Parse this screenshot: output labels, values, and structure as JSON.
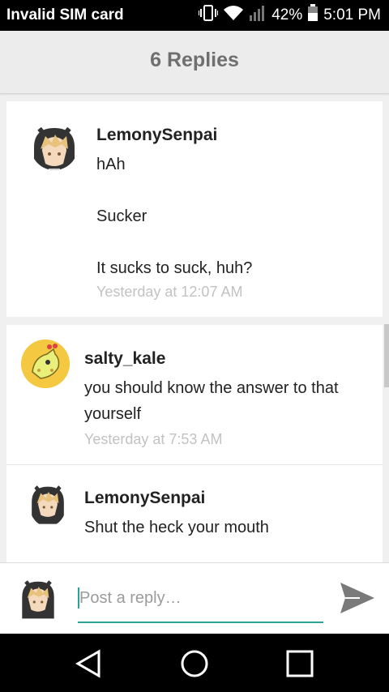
{
  "status_bar": {
    "carrier": "Invalid SIM card",
    "battery": "42%",
    "time": "5:01 PM"
  },
  "header": {
    "title": "6 Replies"
  },
  "comments": [
    {
      "author": "LemonySenpai",
      "lines": [
        "hAh",
        "Sucker",
        "It sucks to suck, huh?"
      ],
      "time": "Yesterday at 12:07 AM",
      "avatar": "anime-avatar-icon"
    },
    {
      "author": "salty_kale",
      "lines": [
        "you should know the answer to that",
        "yourself"
      ],
      "time": "Yesterday at 7:53 AM",
      "avatar": "giraffe-avatar-icon"
    },
    {
      "author": "LemonySenpai",
      "lines": [
        "Shut the heck your mouth"
      ],
      "avatar": "anime-avatar-icon"
    }
  ],
  "reply": {
    "placeholder": "Post a reply…"
  },
  "colors": {
    "accent": "#29a39a",
    "timestamp": "#c2c2c2",
    "header_bg": "#ececec"
  }
}
